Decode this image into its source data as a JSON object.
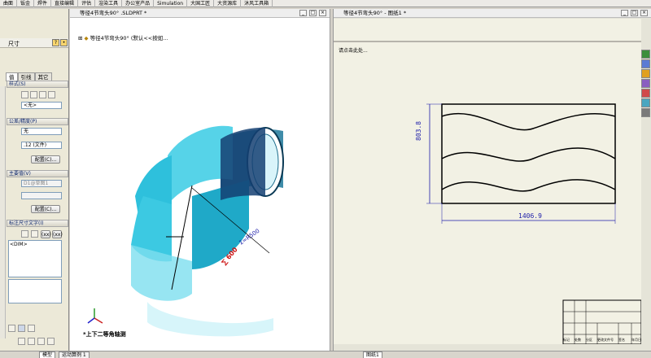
{
  "tabs": [
    "曲面",
    "钣金",
    "焊件",
    "直接编辑",
    "评估",
    "渲染工具",
    "办公室产品",
    "Simulation",
    "大国工匠",
    "大资源库",
    "沐风工具箱"
  ],
  "left_panel": {
    "title": "尺寸",
    "subtabs": [
      "值",
      "引线",
      "其它"
    ],
    "style_section": "样式(S)",
    "style_value": "<无>",
    "tolerance_section": "公差/精度(P)",
    "tolerance_value": "无",
    "precision_value": ".12 (文件)",
    "config_button": "配置(C)...",
    "primary_value_section": "主要值(V)",
    "primary_value_field": "D1@草图1",
    "config_button2": "配置(C)...",
    "dim_text_section": "标注尺寸文字(I)",
    "xx_label": "(xx)",
    "dim_token": "<DIM>"
  },
  "part_window": {
    "title": "等径4节弯头90° .SLDPRT *",
    "tree_root": "等径4节弯头90°  (默认<<按如...",
    "dim_label_1": "Σ=R500",
    "dim_label_2": "∑ 600",
    "view_label": "*上下二等角轴测"
  },
  "drawing_window": {
    "title": "等径4节弯头90° - 图纸1 *",
    "sheet_note": "请点击此处...",
    "height_dim": "803.8",
    "width_dim": "1406.9",
    "tb_labels": [
      "标记",
      "处数",
      "分区",
      "更改文件号",
      "签名",
      "年月日"
    ]
  },
  "bottom": {
    "tabs": [
      "模型",
      "运动算例 1"
    ],
    "sheet_tab": "图纸1"
  }
}
